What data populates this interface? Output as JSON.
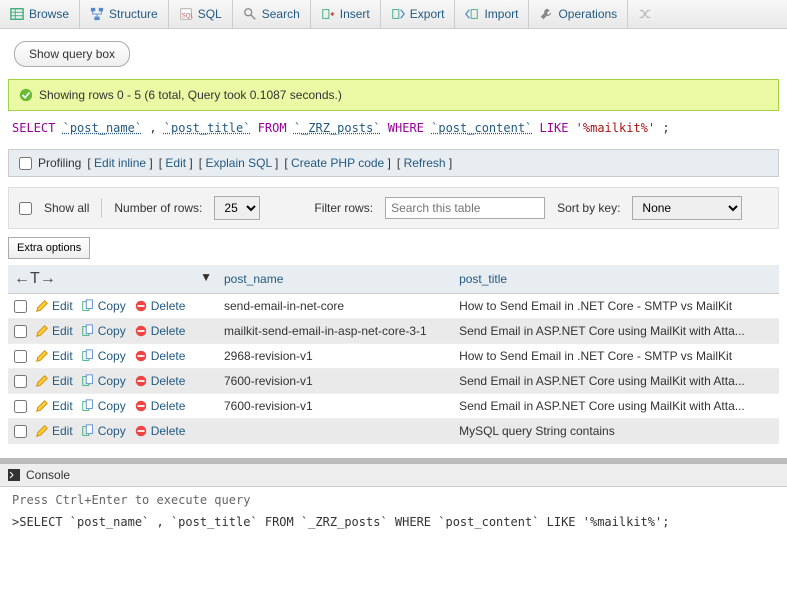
{
  "tabs": {
    "browse": "Browse",
    "structure": "Structure",
    "sql": "SQL",
    "search": "Search",
    "insert": "Insert",
    "export": "Export",
    "import": "Import",
    "operations": "Operations"
  },
  "query_box_btn": "Show query box",
  "success_msg": "Showing rows 0 - 5 (6 total, Query took 0.1087 seconds.)",
  "sql_parts": {
    "select": "SELECT",
    "col1": "`post_name`",
    "comma": " , ",
    "col2": "`post_title`",
    "from": " FROM ",
    "table": "`_ZRZ_posts`",
    "where": " WHERE ",
    "col3": "`post_content`",
    "like": " LIKE ",
    "str": "'%mailkit%'",
    "semi": ";"
  },
  "ops": {
    "profiling": "Profiling",
    "edit_inline": "Edit inline",
    "edit": "Edit",
    "explain": "Explain SQL",
    "create_php": "Create PHP code",
    "refresh": "Refresh"
  },
  "ctrl": {
    "show_all": "Show all",
    "num_rows_label": "Number of rows:",
    "num_rows_value": "25",
    "filter_label": "Filter rows:",
    "filter_placeholder": "Search this table",
    "sort_label": "Sort by key:",
    "sort_value": "None"
  },
  "extra_options": "Extra options",
  "columns": {
    "post_name": "post_name",
    "post_title": "post_title"
  },
  "row_actions": {
    "edit": "Edit",
    "copy": "Copy",
    "delete": "Delete"
  },
  "rows": [
    {
      "post_name": "send-email-in-net-core",
      "post_title": "How to Send Email in .NET Core - SMTP vs MailKit"
    },
    {
      "post_name": "mailkit-send-email-in-asp-net-core-3-1",
      "post_title": "Send Email in ASP.NET Core using MailKit with Atta..."
    },
    {
      "post_name": "2968-revision-v1",
      "post_title": "How to Send Email in .NET Core - SMTP vs MailKit"
    },
    {
      "post_name": "7600-revision-v1",
      "post_title": "Send Email in ASP.NET Core using MailKit with Atta..."
    },
    {
      "post_name": "7600-revision-v1",
      "post_title": "Send Email in ASP.NET Core using MailKit with Atta..."
    },
    {
      "post_name": "",
      "post_title": "MySQL query String contains"
    }
  ],
  "console": {
    "title": "Console",
    "hint": "Press Ctrl+Enter to execute query",
    "prompt": ">SELECT `post_name` , `post_title` FROM `_ZRZ_posts` WHERE `post_content` LIKE '%mailkit%';"
  },
  "arrow_ctrl": "←T→"
}
